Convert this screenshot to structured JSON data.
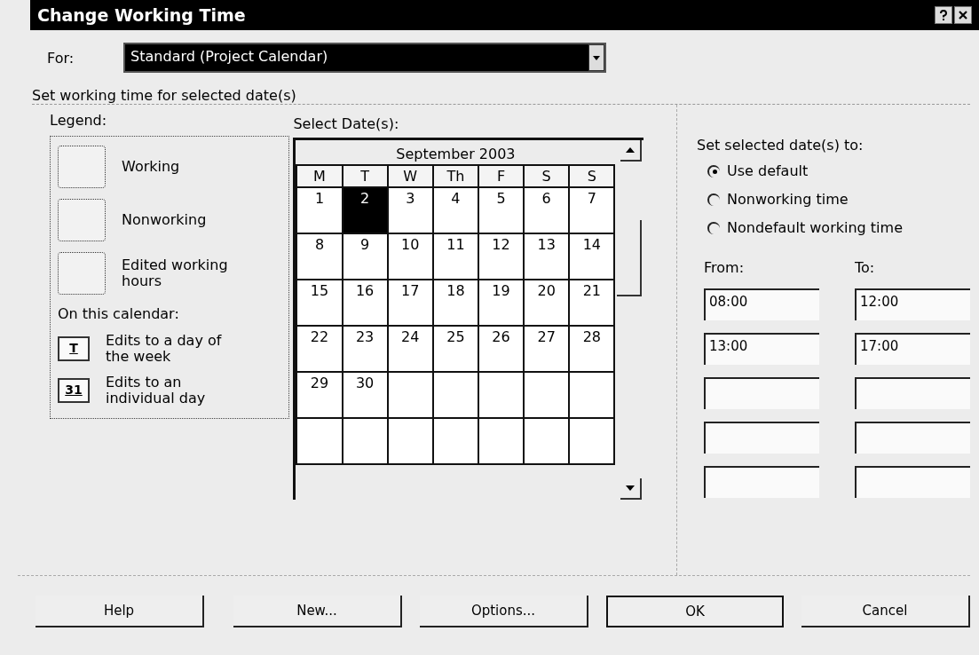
{
  "window": {
    "title": "Change Working Time"
  },
  "for_field": {
    "label": "For:",
    "value": "Standard (Project Calendar)"
  },
  "group": {
    "title": "Set working time for selected date(s)"
  },
  "legend": {
    "title": "Legend:",
    "subtitle": "On this calendar:",
    "items": [
      {
        "kind": "swatch",
        "label": "Working"
      },
      {
        "kind": "swatch",
        "label": "Nonworking"
      },
      {
        "kind": "swatch",
        "label": "Edited working hours"
      }
    ],
    "markers": [
      {
        "mark": "T",
        "label": "Edits to a day of the week"
      },
      {
        "mark": "31",
        "label": "Edits to an individual day"
      }
    ]
  },
  "calendar": {
    "label": "Select Date(s):",
    "month": "September 2003",
    "weekdays": [
      "M",
      "T",
      "W",
      "Th",
      "F",
      "S",
      "S"
    ],
    "weeks": [
      [
        {
          "day": "1",
          "selected": false
        },
        {
          "day": "2",
          "selected": true
        },
        {
          "day": "3",
          "selected": false
        },
        {
          "day": "4",
          "selected": false
        },
        {
          "day": "5",
          "selected": false
        },
        {
          "day": "6",
          "selected": false
        },
        {
          "day": "7",
          "selected": false
        }
      ],
      [
        {
          "day": "8",
          "selected": false
        },
        {
          "day": "9",
          "selected": false
        },
        {
          "day": "10",
          "selected": false
        },
        {
          "day": "11",
          "selected": false
        },
        {
          "day": "12",
          "selected": false
        },
        {
          "day": "13",
          "selected": false
        },
        {
          "day": "14",
          "selected": false
        }
      ],
      [
        {
          "day": "15",
          "selected": false
        },
        {
          "day": "16",
          "selected": false
        },
        {
          "day": "17",
          "selected": false
        },
        {
          "day": "18",
          "selected": false
        },
        {
          "day": "19",
          "selected": false
        },
        {
          "day": "20",
          "selected": false
        },
        {
          "day": "21",
          "selected": false
        }
      ],
      [
        {
          "day": "22",
          "selected": false
        },
        {
          "day": "23",
          "selected": false
        },
        {
          "day": "24",
          "selected": false
        },
        {
          "day": "25",
          "selected": false
        },
        {
          "day": "26",
          "selected": false
        },
        {
          "day": "27",
          "selected": false
        },
        {
          "day": "28",
          "selected": false
        }
      ],
      [
        {
          "day": "29",
          "selected": false
        },
        {
          "day": "30",
          "selected": false
        }
      ]
    ]
  },
  "set_to": {
    "title": "Set selected date(s) to:",
    "options": [
      {
        "label": "Use default",
        "selected": true
      },
      {
        "label": "Nonworking time",
        "selected": false
      },
      {
        "label": "Nondefault working time",
        "selected": false
      }
    ],
    "from_label": "From:",
    "to_label": "To:",
    "time_rows": [
      {
        "from": "08:00",
        "to": "12:00"
      },
      {
        "from": "13:00",
        "to": "17:00"
      },
      {},
      {},
      {}
    ]
  },
  "buttons": [
    {
      "label": "Help",
      "kind": "plain"
    },
    {
      "label": "New...",
      "kind": "plain"
    },
    {
      "label": "Options...",
      "kind": "plain"
    },
    {
      "label": "OK",
      "kind": "default"
    },
    {
      "label": "Cancel",
      "kind": "plain"
    }
  ]
}
